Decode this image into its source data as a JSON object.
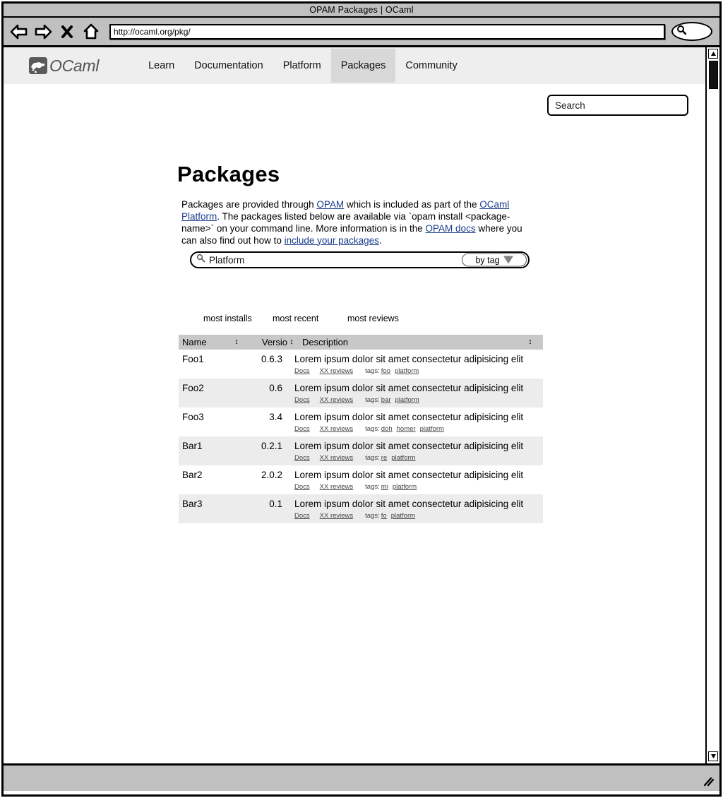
{
  "browser": {
    "title": "OPAM Packages | OCaml",
    "url": "http://ocaml.org/pkg/",
    "icons": {
      "back": "back-arrow-icon",
      "forward": "forward-arrow-icon",
      "stop": "close-x-icon",
      "home": "home-icon",
      "search": "search-icon"
    }
  },
  "site_nav": {
    "logo_text": "OCaml",
    "links": [
      {
        "label": "Learn",
        "active": false
      },
      {
        "label": "Documentation",
        "active": false
      },
      {
        "label": "Platform",
        "active": false
      },
      {
        "label": "Packages",
        "active": true
      },
      {
        "label": "Community",
        "active": false
      }
    ],
    "search_placeholder": "Search"
  },
  "page": {
    "title": "Packages",
    "intro": {
      "part1": "Packages are provided through ",
      "link1": "OPAM",
      "part2": " which is included as part of the ",
      "link2": "OCaml Platform",
      "part3": ".  The packages listed below are available via `opam install <package-name>` on your command line.  More information is in the ",
      "link3": "OPAM docs",
      "part4": " where you can also find out how to ",
      "link4": "include your packages",
      "part5": "."
    }
  },
  "filter": {
    "search_value": "Platform",
    "search_icon": "search-icon",
    "dropdown_label": "by tag",
    "dropdown_icon": "chevron-down-icon"
  },
  "sort_links": [
    {
      "label": "most installs"
    },
    {
      "label": "most recent"
    },
    {
      "label": "most reviews"
    }
  ],
  "table": {
    "headers": {
      "name": "Name",
      "version": "Versio",
      "description": "Description",
      "sort_glyph": "↕"
    },
    "rows": [
      {
        "name": "Foo1",
        "version": "0.6.3",
        "description": "Lorem ipsum dolor sit amet consectetur adipisicing elit",
        "docs": "Docs",
        "reviews": "XX reviews",
        "tags_label": "tags:",
        "tags": [
          "foo",
          "platform"
        ]
      },
      {
        "name": "Foo2",
        "version": "0.6",
        "description": "Lorem ipsum dolor sit amet consectetur adipisicing elit",
        "docs": "Docs",
        "reviews": "XX reviews",
        "tags_label": "tags:",
        "tags": [
          "bar",
          "platform"
        ]
      },
      {
        "name": "Foo3",
        "version": "3.4",
        "description": "Lorem ipsum dolor sit amet consectetur adipisicing elit",
        "docs": "Docs",
        "reviews": "XX reviews",
        "tags_label": "tags:",
        "tags": [
          "doh",
          "homer",
          "platform"
        ]
      },
      {
        "name": "Bar1",
        "version": "0.2.1",
        "description": "Lorem ipsum dolor sit amet consectetur adipisicing elit",
        "docs": "Docs",
        "reviews": "XX reviews",
        "tags_label": "tags:",
        "tags": [
          "re",
          "platform"
        ]
      },
      {
        "name": "Bar2",
        "version": "2.0.2",
        "description": "Lorem ipsum dolor sit amet consectetur adipisicing elit",
        "docs": "Docs",
        "reviews": "XX reviews",
        "tags_label": "tags:",
        "tags": [
          "mi",
          "platform"
        ]
      },
      {
        "name": "Bar3",
        "version": "0.1",
        "description": "Lorem ipsum dolor sit amet consectetur adipisicing elit",
        "docs": "Docs",
        "reviews": "XX reviews",
        "tags_label": "tags:",
        "tags": [
          "fo",
          "platform"
        ]
      }
    ]
  },
  "colors": {
    "chrome": "#c0c0c0",
    "nav_bg": "#eeeeee",
    "nav_active": "#d8d8d8",
    "table_header": "#c8c8c8",
    "row_alt": "#ececec",
    "link": "#1a3c8c"
  }
}
